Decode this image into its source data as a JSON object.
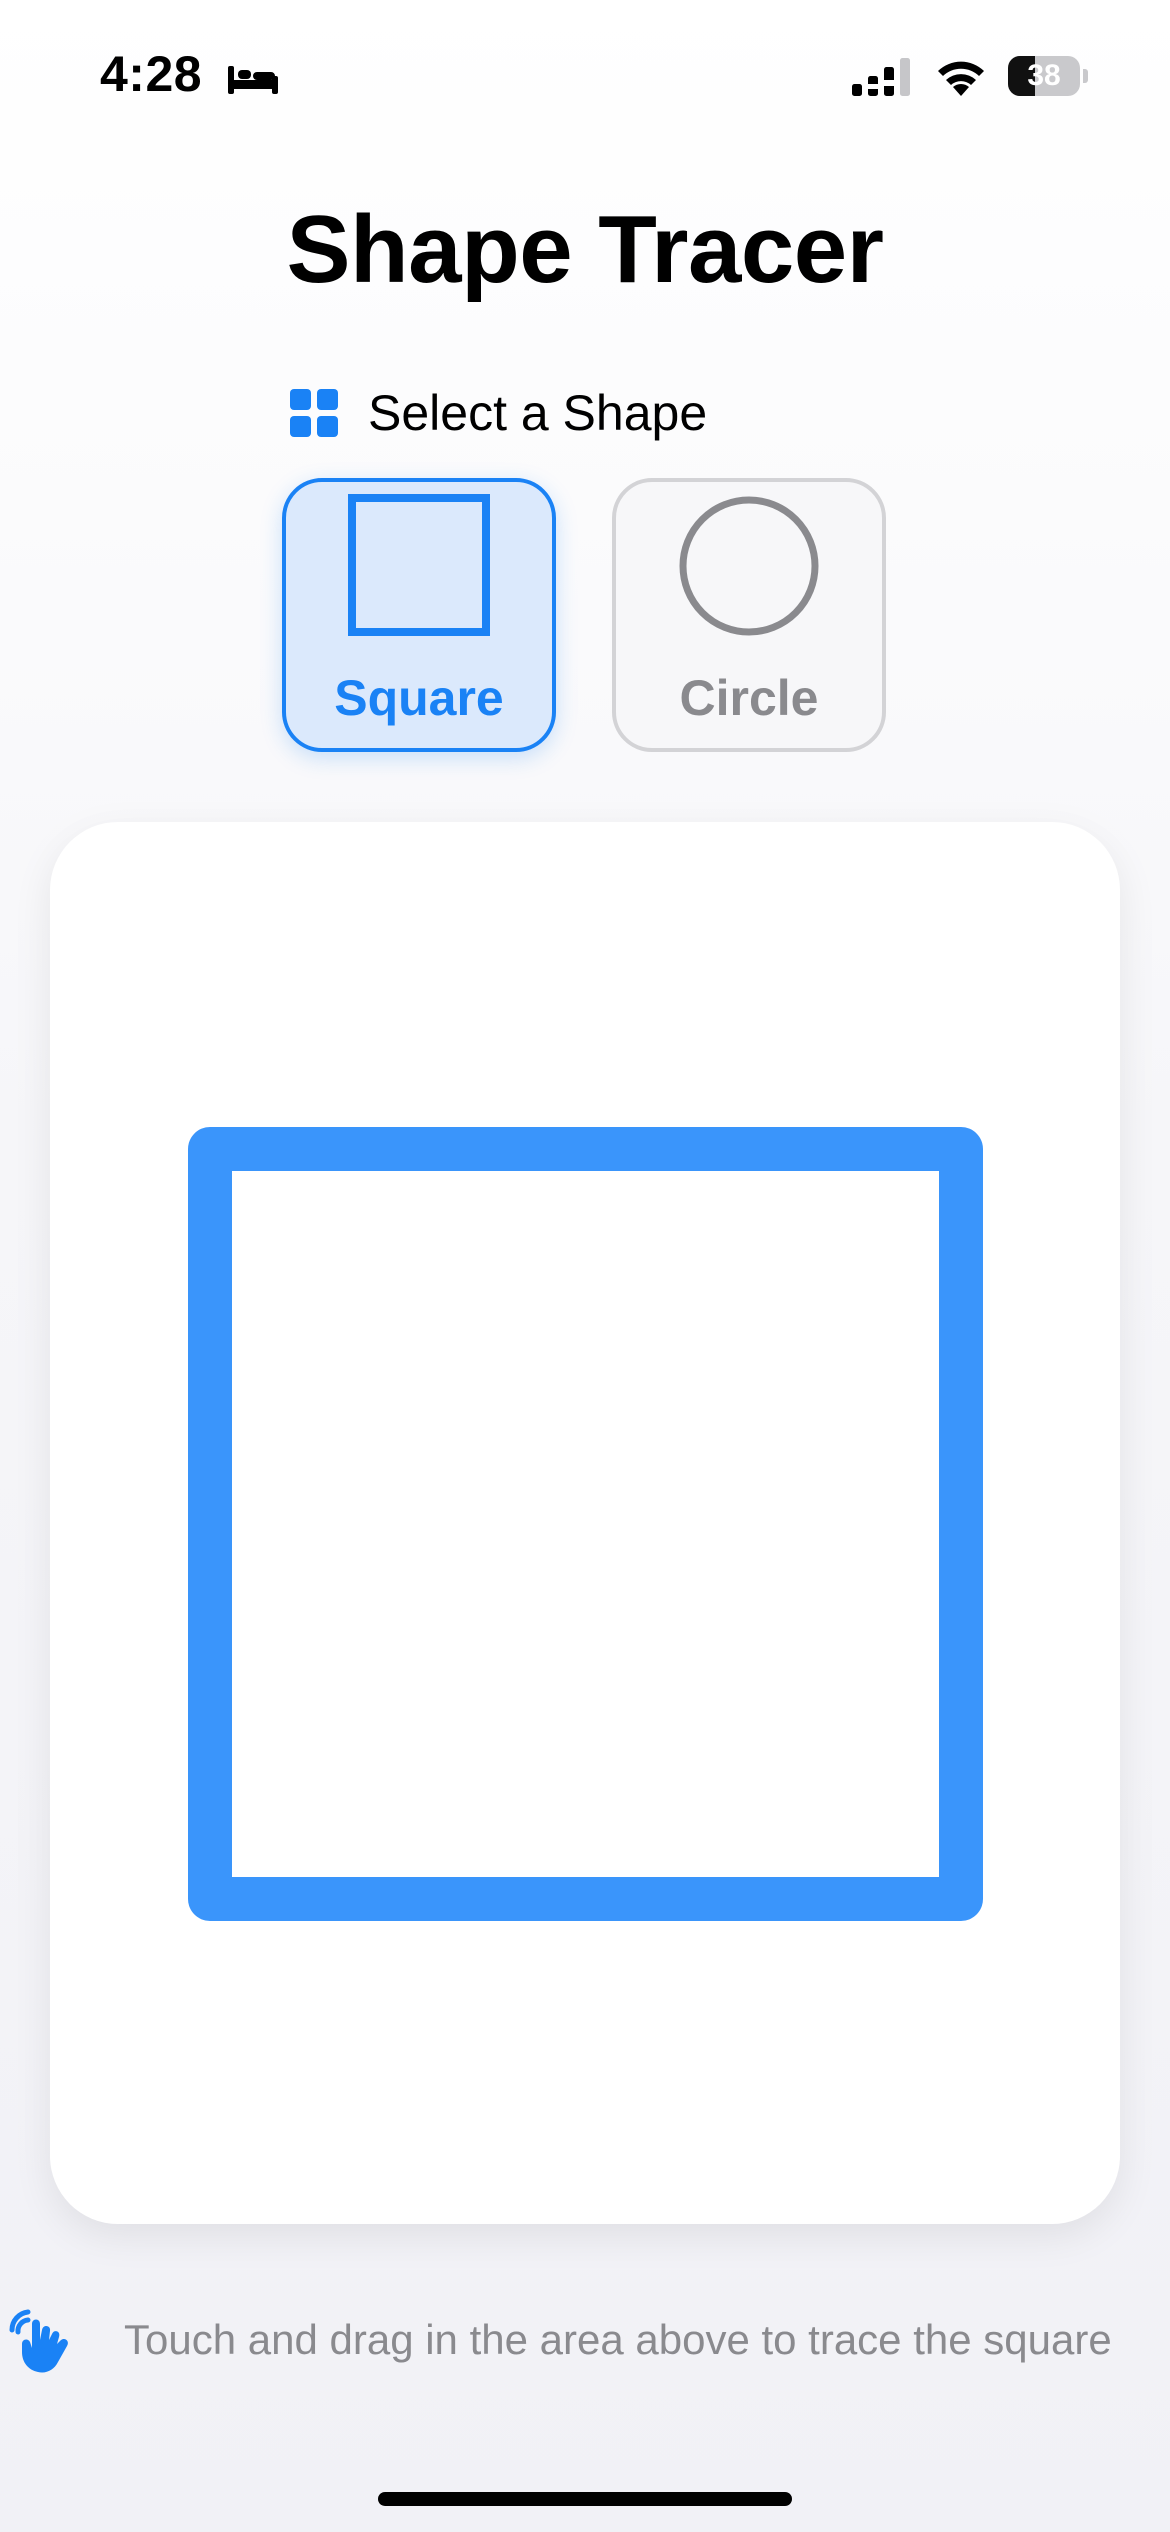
{
  "status_bar": {
    "time": "4:28",
    "focus_icon": "bed-icon",
    "signal_icon": "cellular-signal-icon",
    "wifi_icon": "wifi-icon",
    "battery_level": "38",
    "battery_fraction": 0.38
  },
  "app": {
    "title": "Shape Tracer"
  },
  "shape_picker": {
    "header_icon": "grid-icon",
    "header_label": "Select a Shape",
    "selected": "Square",
    "options": [
      {
        "label": "Square",
        "icon": "square-icon",
        "selected": true
      },
      {
        "label": "Circle",
        "icon": "circle-icon",
        "selected": false
      }
    ]
  },
  "instruction": {
    "icon": "hand-tap-icon",
    "text": "Touch and drag in the area above to trace the square"
  },
  "colors": {
    "accent": "#1a82f5",
    "trace": "#3a95fb",
    "muted": "#8a8a8e"
  }
}
